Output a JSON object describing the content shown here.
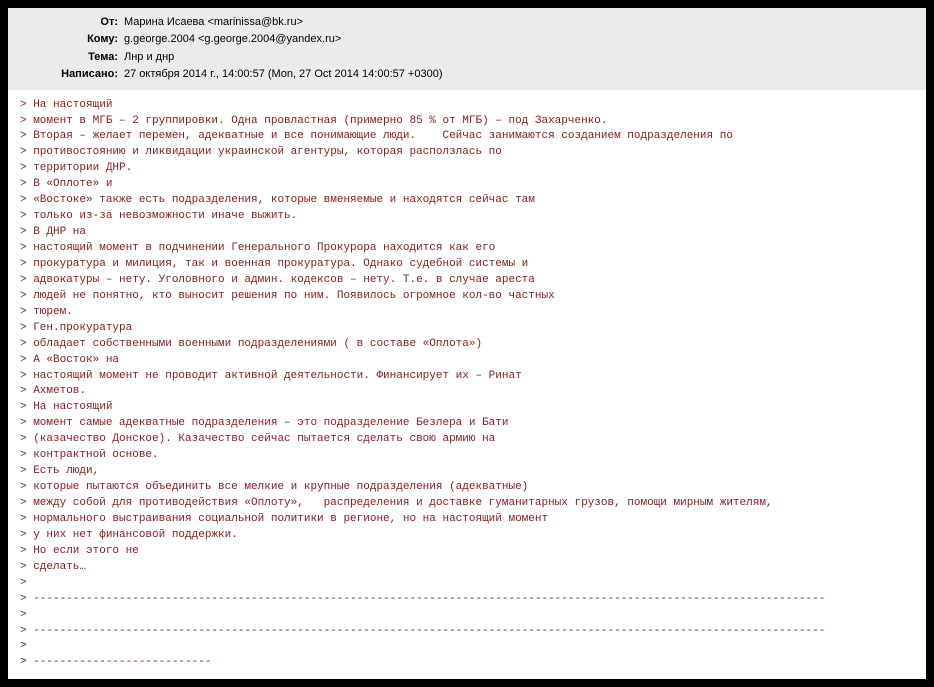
{
  "header": {
    "from_label": "От:",
    "from_value": "Марина Исаева <marinissa@bk.ru>",
    "to_label": "Кому:",
    "to_value": "g.george.2004 <g.george.2004@yandex.ru>",
    "subject_label": "Тема:",
    "subject_value": "Лнр и днр",
    "date_label": "Написано:",
    "date_value": "27 октября 2014 г., 14:00:57  (Mon, 27 Oct 2014 14:00:57 +0300)"
  },
  "body_lines": [
    "> На настоящий",
    "> момент в МГБ – 2 группировки. Одна провластная (примерно 85 % от МГБ) – под Захарченко.",
    "> Вторая – желает перемен, адекватные и все понимающие люди.    Сейчас занимаются созданием подразделения по",
    "> противостоянию и ликвидации украинской агентуры, которая расползлась по",
    "> территории ДНР.",
    "> В «Оплоте» и",
    "> «Востоке» также есть подразделения, которые вменяемые и находятся сейчас там",
    "> только из-за невозможности иначе выжить.",
    "> В ДНР на",
    "> настоящий момент в подчинении Генерального Прокурора находится как его",
    "> прокуратура и милиция, так и военная прокуратура. Однако судебной системы и",
    "> адвокатуры – нету. Уголовного и админ. кодексов – нету. Т.е. в случае ареста",
    "> людей не понятно, кто выносит решения по ним. Появилось огромное кол-во частных",
    "> тюрем.",
    "> Ген.прокуратура",
    "> обладает собственными военными подразделениями ( в составе «Оплота»)",
    "> А «Восток» на",
    "> настоящий момент не проводит активной деятельности. Финансирует их – Ринат",
    "> Ахметов.",
    "> На настоящий",
    "> момент самые адекватные подразделения – это подразделение Безлера и Бати",
    "> (казачество Донское). Казачество сейчас пытается сделать свою армию на",
    "> контрактной основе.",
    "> Есть люди,",
    "> которые пытаются объединить все мелкие и крупные подразделения (адекватные)",
    "> между собой для противодействия «Оплоту»,   распределения и доставке гуманитарных грузов, помощи мирным жителям,",
    "> нормального выстраивания социальной политики в регионе, но на настоящий момент",
    "> у них нет финансовой поддержки.",
    "> Но если этого не",
    "> сделать…",
    ">",
    "> ------------------------------------------------------------------------------------------------------------------------",
    ">",
    "> ------------------------------------------------------------------------------------------------------------------------",
    ">",
    "> ---------------------------"
  ]
}
